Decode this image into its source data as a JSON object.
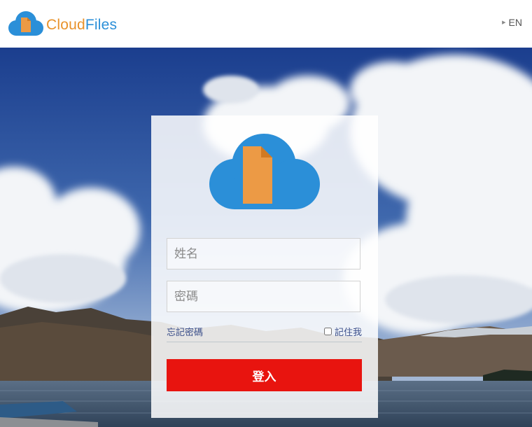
{
  "header": {
    "brand_part1": "Cloud",
    "brand_part2": "Files",
    "language_label": "EN",
    "language_caret_icon": "triangle-right-icon"
  },
  "login": {
    "username_placeholder": "姓名",
    "password_placeholder": "密碼",
    "forgot_password_label": "忘記密碼",
    "remember_me_label": "記住我",
    "remember_me_checked": false,
    "submit_label": "登入"
  },
  "colors": {
    "brand_orange": "#e8922b",
    "brand_blue": "#2b8fd8",
    "login_button": "#e8140f",
    "link_text": "#3a4e8a"
  }
}
